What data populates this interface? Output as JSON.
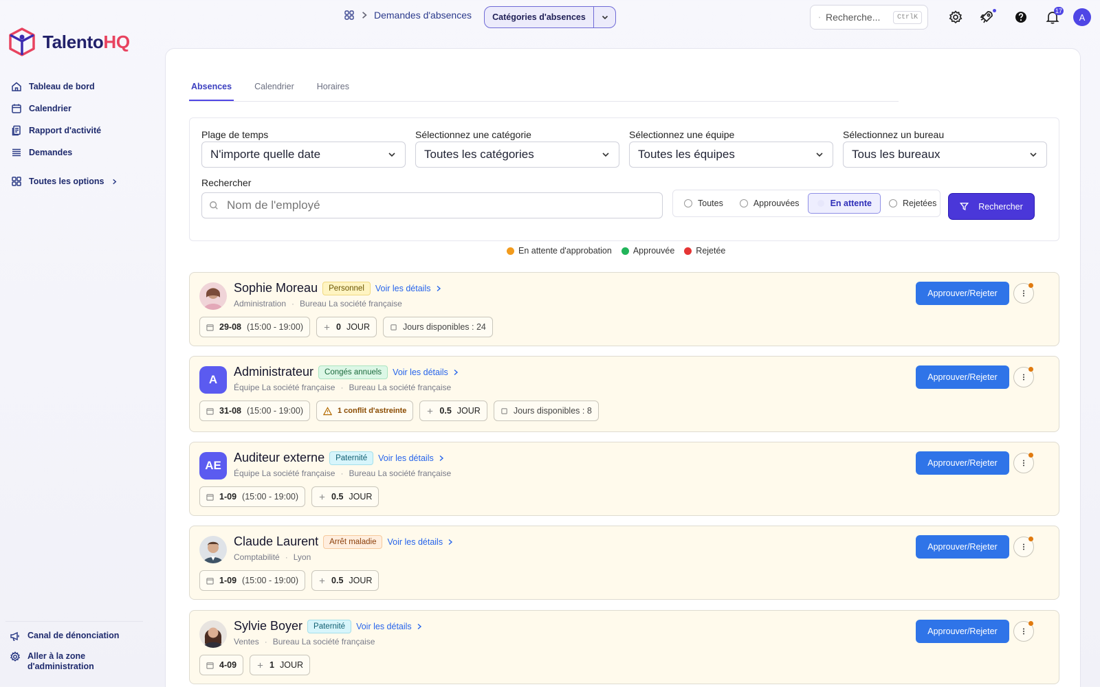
{
  "brand": {
    "name_part1": "Talento",
    "name_part2": "HQ",
    "accent": "#e8435f",
    "primary": "#22216a"
  },
  "sidebar": {
    "items": [
      {
        "label": "Tableau de bord",
        "icon": "home-icon"
      },
      {
        "label": "Calendrier",
        "icon": "calendar-icon"
      },
      {
        "label": "Rapport d'activité",
        "icon": "report-icon"
      },
      {
        "label": "Demandes",
        "icon": "list-icon"
      }
    ],
    "all_options": "Toutes les options",
    "bottom": [
      {
        "label": "Canal de dénonciation",
        "icon": "megaphone-icon"
      },
      {
        "label": "Aller à la zone d'administration",
        "icon": "gear-icon"
      }
    ]
  },
  "topbar": {
    "breadcrumb": "Demandes d'absences",
    "split_button": "Catégories d'absences",
    "search_placeholder": "Recherche...",
    "search_shortcut": "CtrlK",
    "notifications_count": "17",
    "avatar_initial": "A"
  },
  "tabs": [
    "Absences",
    "Calendrier",
    "Horaires"
  ],
  "filters": {
    "time_range": {
      "label": "Plage de temps",
      "value": "N'importe quelle date"
    },
    "category": {
      "label": "Sélectionnez une catégorie",
      "value": "Toutes les catégories"
    },
    "team": {
      "label": "Sélectionnez une équipe",
      "value": "Toutes les équipes"
    },
    "office": {
      "label": "Sélectionnez un bureau",
      "value": "Tous les bureaux"
    },
    "search_label": "Rechercher",
    "search_placeholder": "Nom de l'employé",
    "statuses": [
      "Toutes",
      "Approuvées",
      "En attente",
      "Rejetées"
    ],
    "active_status": "En attente",
    "search_button": "Rechercher"
  },
  "legend": [
    {
      "label": "En attente d'approbation",
      "color": "#f29b1d"
    },
    {
      "label": "Approuvée",
      "color": "#22b45a"
    },
    {
      "label": "Rejetée",
      "color": "#e53535"
    }
  ],
  "requests": [
    {
      "name": "Sophie Moreau",
      "tag": "Personnel",
      "tag_color": "yellow",
      "meta1": "Administration",
      "meta2": "Bureau La société française",
      "date": "29-08",
      "time": "(15:00 - 19:00)",
      "days": "0",
      "unit": "JOUR",
      "available": "Jours disponibles : 24",
      "conflict": null
    },
    {
      "name": "Administrateur",
      "tag": "Congés annuels",
      "tag_color": "green",
      "initials": "A",
      "meta1": "Équipe La société française",
      "meta2": "Bureau La société française",
      "date": "31-08",
      "time": "(15:00 - 19:00)",
      "days": "0.5",
      "unit": "JOUR",
      "available": "Jours disponibles : 8",
      "conflict": "1 conflit d'astreinte"
    },
    {
      "name": "Auditeur externe",
      "tag": "Paternité",
      "tag_color": "cyan",
      "initials": "AE",
      "meta1": "Équipe La société française",
      "meta2": "Bureau La société française",
      "date": "1-09",
      "time": "(15:00 - 19:00)",
      "days": "0.5",
      "unit": "JOUR",
      "available": null,
      "conflict": null
    },
    {
      "name": "Claude Laurent",
      "tag": "Arrêt maladie",
      "tag_color": "orange",
      "meta1": "Comptabilité",
      "meta2": "Lyon",
      "date": "1-09",
      "time": "(15:00 - 19:00)",
      "days": "0.5",
      "unit": "JOUR",
      "available": null,
      "conflict": null
    },
    {
      "name": "Sylvie Boyer",
      "tag": "Paternité",
      "tag_color": "cyan",
      "meta1": "Ventes",
      "meta2": "Bureau La société française",
      "date": "4-09",
      "time": null,
      "days": "1",
      "unit": "JOUR",
      "available": null,
      "conflict": null
    }
  ],
  "card_actions": {
    "approve": "Approuver/Rejeter",
    "details": "Voir les détails"
  }
}
